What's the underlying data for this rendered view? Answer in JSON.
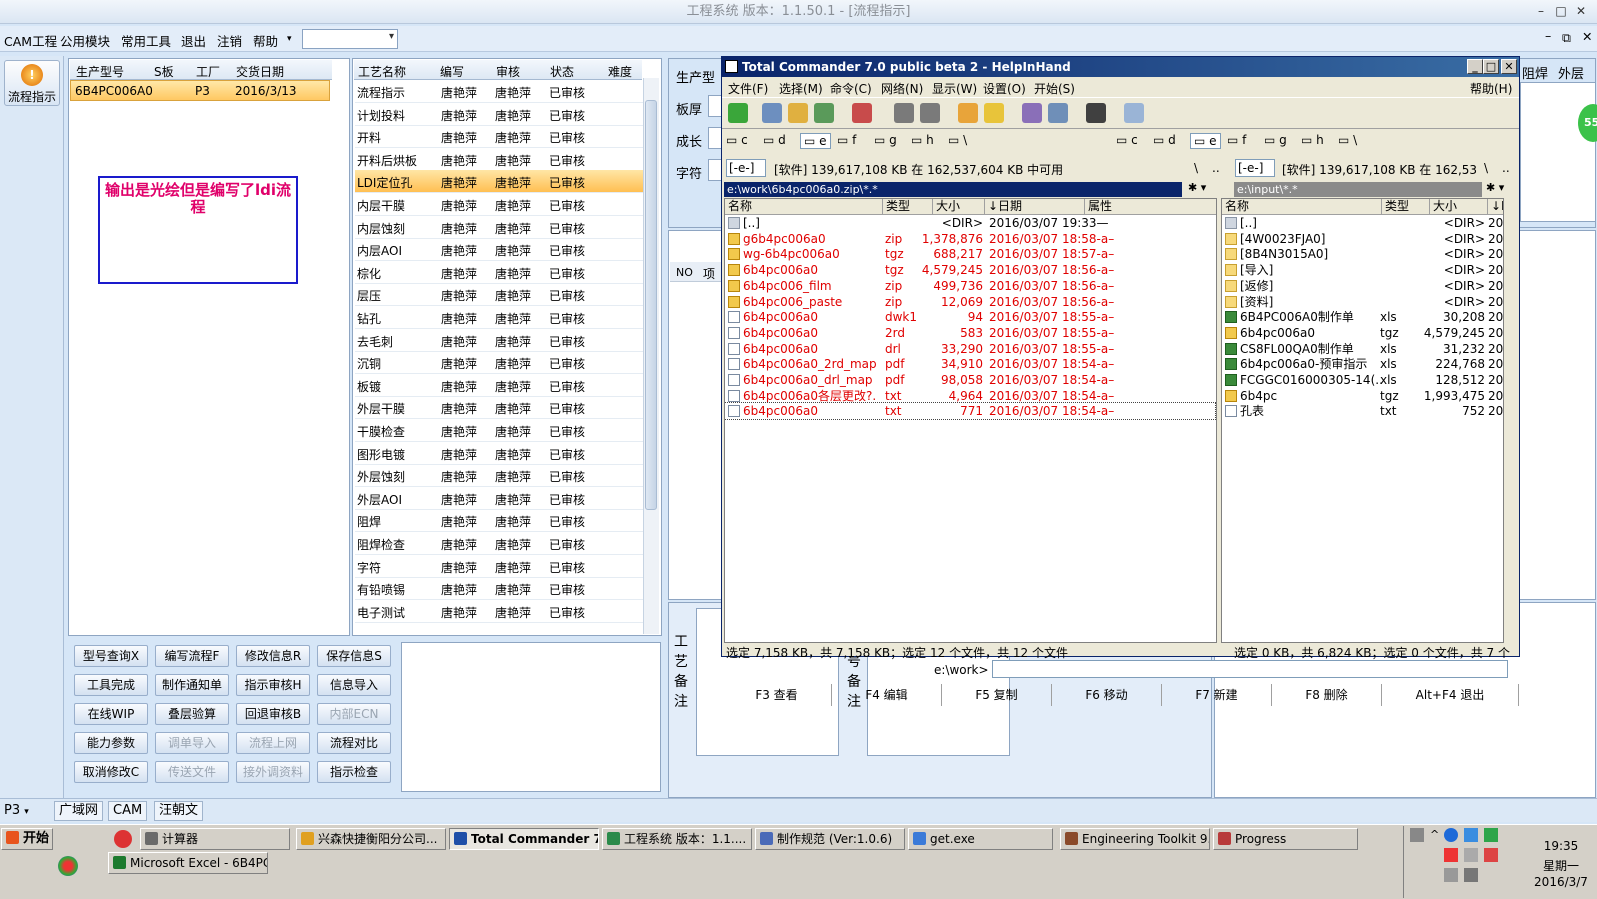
{
  "app": {
    "title": "工程系统   版本：1.1.50.1 - [流程指示]",
    "menu": [
      "CAM工程",
      "公用模块",
      "常用工具",
      "退出",
      "注销",
      "帮助"
    ]
  },
  "left": {
    "flow_button": "流程指示"
  },
  "prod": {
    "headers": [
      "生产型号",
      "S板",
      "工厂",
      "交货日期"
    ],
    "row": [
      "6B4PC006A0",
      "",
      "P3",
      "2016/3/13"
    ],
    "note": "输出是光绘但是编写了ldi流程"
  },
  "proc": {
    "headers": [
      "工艺名称",
      "编写",
      "审核",
      "状态",
      "难度"
    ],
    "rows": [
      [
        "流程指示",
        "唐艳萍",
        "唐艳萍",
        "已审核"
      ],
      [
        "计划投料",
        "唐艳萍",
        "唐艳萍",
        "已审核"
      ],
      [
        "开料",
        "唐艳萍",
        "唐艳萍",
        "已审核"
      ],
      [
        "开料后烘板",
        "唐艳萍",
        "唐艳萍",
        "已审核"
      ],
      [
        "LDI定位孔",
        "唐艳萍",
        "唐艳萍",
        "已审核"
      ],
      [
        "内层干膜",
        "唐艳萍",
        "唐艳萍",
        "已审核"
      ],
      [
        "内层蚀刻",
        "唐艳萍",
        "唐艳萍",
        "已审核"
      ],
      [
        "内层AOI",
        "唐艳萍",
        "唐艳萍",
        "已审核"
      ],
      [
        "棕化",
        "唐艳萍",
        "唐艳萍",
        "已审核"
      ],
      [
        "层压",
        "唐艳萍",
        "唐艳萍",
        "已审核"
      ],
      [
        "钻孔",
        "唐艳萍",
        "唐艳萍",
        "已审核"
      ],
      [
        "去毛刺",
        "唐艳萍",
        "唐艳萍",
        "已审核"
      ],
      [
        "沉铜",
        "唐艳萍",
        "唐艳萍",
        "已审核"
      ],
      [
        "板镀",
        "唐艳萍",
        "唐艳萍",
        "已审核"
      ],
      [
        "外层干膜",
        "唐艳萍",
        "唐艳萍",
        "已审核"
      ],
      [
        "干膜检查",
        "唐艳萍",
        "唐艳萍",
        "已审核"
      ],
      [
        "图形电镀",
        "唐艳萍",
        "唐艳萍",
        "已审核"
      ],
      [
        "外层蚀刻",
        "唐艳萍",
        "唐艳萍",
        "已审核"
      ],
      [
        "外层AOI",
        "唐艳萍",
        "唐艳萍",
        "已审核"
      ],
      [
        "阻焊",
        "唐艳萍",
        "唐艳萍",
        "已审核"
      ],
      [
        "阻焊检查",
        "唐艳萍",
        "唐艳萍",
        "已审核"
      ],
      [
        "字符",
        "唐艳萍",
        "唐艳萍",
        "已审核"
      ],
      [
        "有铅喷锡",
        "唐艳萍",
        "唐艳萍",
        "已审核"
      ],
      [
        "电子测试",
        "唐艳萍",
        "唐艳萍",
        "已审核"
      ]
    ]
  },
  "buttons": [
    [
      "型号查询X",
      "编写流程F",
      "修改信息R",
      "保存信息S"
    ],
    [
      "工具完成",
      "制作通知单",
      "指示审核H",
      "信息导入"
    ],
    [
      "在线WIP",
      "叠层验算",
      "回退审核B",
      "内部ECN"
    ],
    [
      "能力参数",
      "调单导入",
      "流程上网",
      "流程对比"
    ],
    [
      "取消修改C",
      "传送文件",
      "接外调资料",
      "指示检查"
    ]
  ],
  "right": {
    "labels": [
      "生产型",
      "板厚",
      "成长",
      "字符"
    ],
    "tabs": [
      "阻焊",
      "外层"
    ],
    "col_no": "NO",
    "col_item": "项",
    "gy_note": [
      "工",
      "艺",
      "备",
      "注"
    ],
    "hao_note": [
      "号",
      "备",
      "注"
    ],
    "badge": "55"
  },
  "tc": {
    "title": "Total Commander 7.0 public beta 2 - HelpInHand",
    "menu": [
      "文件(F)",
      "选择(M)",
      "命令(C)",
      "网络(N)",
      "显示(W)",
      "设置(O)",
      "开始(S)",
      "帮助(H)"
    ],
    "drives": [
      "c",
      "d",
      "e",
      "f",
      "g",
      "h",
      "\\"
    ],
    "left": {
      "drive": "[-e-]",
      "free": "[软件]  139,617,108 KB 在 162,537,604 KB 中可用",
      "path": "e:\\work\\6b4pc006a0.zip\\*.*",
      "headers": [
        "名称",
        "类型",
        "大小",
        "↓日期",
        "属性"
      ],
      "files": [
        {
          "n": "[..]",
          "t": "",
          "s": "<DIR>",
          "d": "2016/03/07 19:33—",
          "i": "up",
          "c": 0
        },
        {
          "n": "g6b4pc006a0",
          "t": "zip",
          "s": "1,378,876",
          "d": "2016/03/07 18:58-a–",
          "i": "arc",
          "c": 1
        },
        {
          "n": "wg-6b4pc006a0",
          "t": "tgz",
          "s": "688,217",
          "d": "2016/03/07 18:57-a–",
          "i": "arc",
          "c": 1
        },
        {
          "n": "6b4pc006a0",
          "t": "tgz",
          "s": "4,579,245",
          "d": "2016/03/07 18:56-a–",
          "i": "arc",
          "c": 1
        },
        {
          "n": "6b4pc006_film",
          "t": "zip",
          "s": "499,736",
          "d": "2016/03/07 18:56-a–",
          "i": "arc",
          "c": 1
        },
        {
          "n": "6b4pc006_paste",
          "t": "zip",
          "s": "12,069",
          "d": "2016/03/07 18:56-a–",
          "i": "arc",
          "c": 1
        },
        {
          "n": "6b4pc006a0",
          "t": "dwk1",
          "s": "94",
          "d": "2016/03/07 18:55-a–",
          "i": "doc",
          "c": 1
        },
        {
          "n": "6b4pc006a0",
          "t": "2rd",
          "s": "583",
          "d": "2016/03/07 18:55-a–",
          "i": "doc",
          "c": 1
        },
        {
          "n": "6b4pc006a0",
          "t": "drl",
          "s": "33,290",
          "d": "2016/03/07 18:55-a–",
          "i": "doc",
          "c": 1
        },
        {
          "n": "6b4pc006a0_2rd_map",
          "t": "pdf",
          "s": "34,910",
          "d": "2016/03/07 18:54-a–",
          "i": "doc",
          "c": 1
        },
        {
          "n": "6b4pc006a0_drl_map",
          "t": "pdf",
          "s": "98,058",
          "d": "2016/03/07 18:54-a–",
          "i": "doc",
          "c": 1
        },
        {
          "n": "6b4pc006a0各层更改?.",
          "t": "txt",
          "s": "4,964",
          "d": "2016/03/07 18:54-a–",
          "i": "doc",
          "c": 1
        },
        {
          "n": "6b4pc006a0",
          "t": "txt",
          "s": "771",
          "d": "2016/03/07 18:54-a–",
          "i": "doc",
          "c": 1
        }
      ],
      "status": "选定 7,158 KB，共 7,158 KB；选定 12 个文件，共 12 个文件"
    },
    "right": {
      "drive": "[-e-]",
      "free": "[软件]  139,617,108 KB 在 162,53",
      "path": "e:\\input\\*.*",
      "headers": [
        "名称",
        "类型",
        "大小",
        "↓E"
      ],
      "files": [
        {
          "n": "[..]",
          "t": "",
          "s": "<DIR>",
          "d": "20",
          "i": "up"
        },
        {
          "n": "[4W0023FJA0]",
          "t": "",
          "s": "<DIR>",
          "d": "20",
          "i": "dir"
        },
        {
          "n": "[8B4N3015A0]",
          "t": "",
          "s": "<DIR>",
          "d": "20",
          "i": "dir"
        },
        {
          "n": "[导入]",
          "t": "",
          "s": "<DIR>",
          "d": "20",
          "i": "dir"
        },
        {
          "n": "[返修]",
          "t": "",
          "s": "<DIR>",
          "d": "20",
          "i": "dir"
        },
        {
          "n": "[资料]",
          "t": "",
          "s": "<DIR>",
          "d": "20",
          "i": "dir"
        },
        {
          "n": "6B4PC006A0制作单",
          "t": "xls",
          "s": "30,208",
          "d": "20",
          "i": "xls"
        },
        {
          "n": "6b4pc006a0",
          "t": "tgz",
          "s": "4,579,245",
          "d": "20",
          "i": "arc"
        },
        {
          "n": "CS8FL00QA0制作单",
          "t": "xls",
          "s": "31,232",
          "d": "20",
          "i": "xls"
        },
        {
          "n": "6b4pc006a0-预审指示",
          "t": "xls",
          "s": "224,768",
          "d": "20",
          "i": "xls"
        },
        {
          "n": "FCGGC016000305-14(..",
          "t": "xls",
          "s": "128,512",
          "d": "20",
          "i": "xls"
        },
        {
          "n": "6b4pc",
          "t": "tgz",
          "s": "1,993,475",
          "d": "20",
          "i": "arc"
        },
        {
          "n": "孔表",
          "t": "txt",
          "s": "752",
          "d": "20",
          "i": "doc"
        }
      ],
      "status": "选定 0 KB，共 6,824 KB；选定 0 个文件，共 7 个文"
    },
    "cmd_label": "e:\\work>",
    "fkeys": [
      "F3 查看",
      "F4 编辑",
      "F5 复制",
      "F6 移动",
      "F7 新建",
      "F8 删除",
      "Alt+F4 退出"
    ]
  },
  "bottom": {
    "combo": "P3",
    "tabs": [
      "广域网",
      "CAM",
      "汪朝文"
    ]
  },
  "taskbar": {
    "start": "开始",
    "items": [
      "计算器",
      "兴森快捷衡阳分公司...",
      "Total Commander 7....",
      "工程系统   版本：1.1....",
      "制作规范 (Ver:1.0.6)",
      "get.exe",
      "Engineering Toolkit 9.0...",
      "Progress"
    ],
    "excel": "Microsoft Excel - 6B4PC0...",
    "time": "19:35",
    "weekday": "星期一",
    "date": "2016/3/7"
  }
}
